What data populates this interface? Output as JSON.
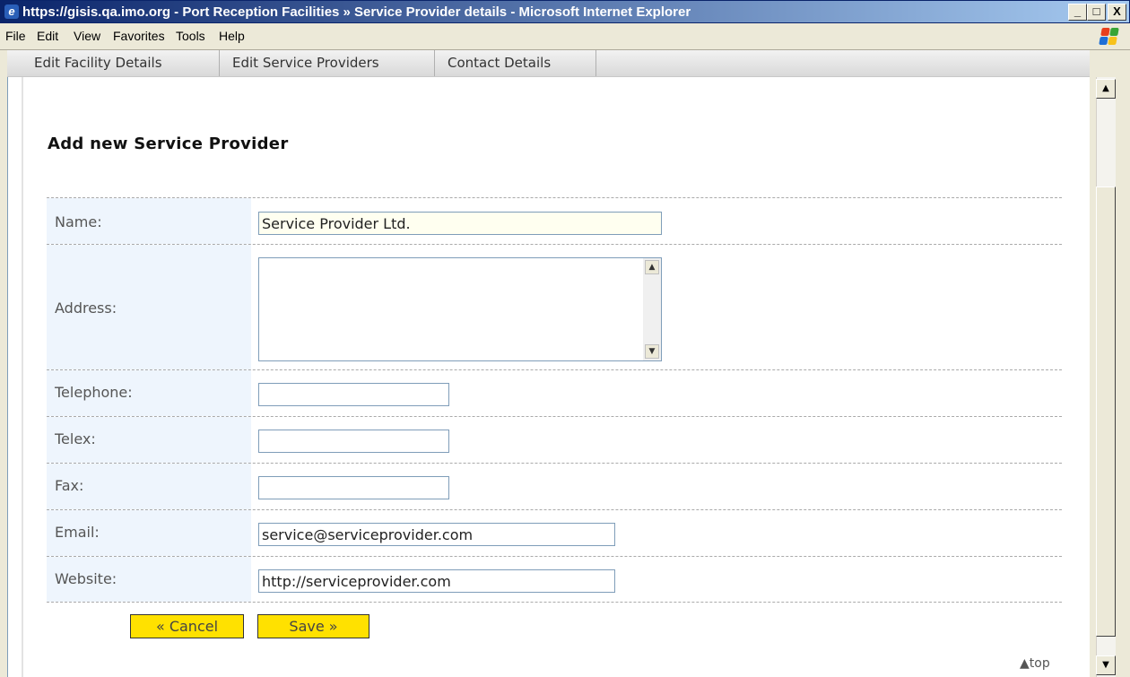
{
  "window": {
    "title": "https://gisis.qa.imo.org - Port Reception Facilities » Service Provider details - Microsoft Internet Explorer",
    "minimize": "_",
    "maximize": "□",
    "close": "X"
  },
  "menu": [
    {
      "label": "File"
    },
    {
      "label": "Edit"
    },
    {
      "label": "View"
    },
    {
      "label": "Favorites"
    },
    {
      "label": "Tools"
    },
    {
      "label": "Help"
    }
  ],
  "tabs": [
    {
      "label": "Edit Facility Details"
    },
    {
      "label": "Edit Service Providers"
    },
    {
      "label": "Contact Details"
    }
  ],
  "form": {
    "heading": "Add new Service Provider",
    "name_label": "Name:",
    "name_value": "Service Provider Ltd.",
    "address_label": "Address:",
    "address_value": "",
    "telephone_label": "Telephone:",
    "telephone_value": "",
    "telex_label": "Telex:",
    "telex_value": "",
    "fax_label": "Fax:",
    "fax_value": "",
    "email_label": "Email:",
    "email_value": "service@serviceprovider.com",
    "website_label": "Website:",
    "website_value": "http://serviceprovider.com"
  },
  "actions": {
    "cancel": "« Cancel",
    "save": "Save »",
    "top_link": "▲top"
  },
  "colors": {
    "button": "#ffe100",
    "label_bg": "#eef5fd",
    "name_field_bg": "#fffff0"
  }
}
